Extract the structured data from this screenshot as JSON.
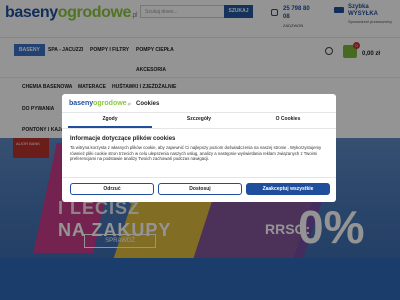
{
  "header": {
    "logo": {
      "part1": "baseny",
      "part2": "ogrodowe",
      "part3": ".pl"
    },
    "search_placeholder": "Szukaj dowo...",
    "search_button": "SZUKAJ",
    "phone": "25 798 80 08",
    "phone_sub": "ZADZWOŃ",
    "shipping_title": "Szybka WYSYŁKA",
    "shipping_sub": "Sprawdzeni przewoźnicy"
  },
  "nav": {
    "items": [
      "BASENY",
      "SPA - JACUZZI",
      "POMPY I FILTRY",
      "POMPY CIEPŁA",
      "AKCESORIA",
      "CHEMIA BASENOWA",
      "MATERACE",
      "HUŚTAWKI I ZJEŻDŻALNIE",
      "DO PYWANIA",
      "PONTONY I KAJAKI"
    ],
    "cart_count": "0",
    "cart_total": "0,00 zł"
  },
  "banner": {
    "alior_text": "ALIOR BANK",
    "line1": "I LECISZ",
    "line2": "NA ZAKUPY",
    "rrso_label": "RRSO:",
    "rrso_value": "0%",
    "cta": "SPRAWDŹ"
  },
  "cookie_modal": {
    "logo": {
      "part1": "baseny",
      "part2": "ogrodowe",
      "part3": ".pl"
    },
    "title": "Cookies",
    "tabs": [
      "Zgody",
      "Szczegóły",
      "O Cookies"
    ],
    "active_tab": "Zgody",
    "heading": "Informacje dotyczące plików cookies",
    "body": "Ta witryna korzysta z własnych plików cookie, aby zapewnić Ci najlepszy poziom doświadczenia na naszej stronie . Wykorzystujemy również pliki cookie stron trzecich w celu ulepszenia naszych usług, analizy a następnie wyświetlania reklam związanych z Twoimi preferencjami na podstawie analizy Twoich zachowań podczas nawigacji.",
    "buttons": {
      "reject": "Odrzuć",
      "customize": "Dostosuj",
      "accept": "Zaakceptuj wszystkie"
    },
    "colors": {
      "accent": "#1f4e9c"
    }
  }
}
